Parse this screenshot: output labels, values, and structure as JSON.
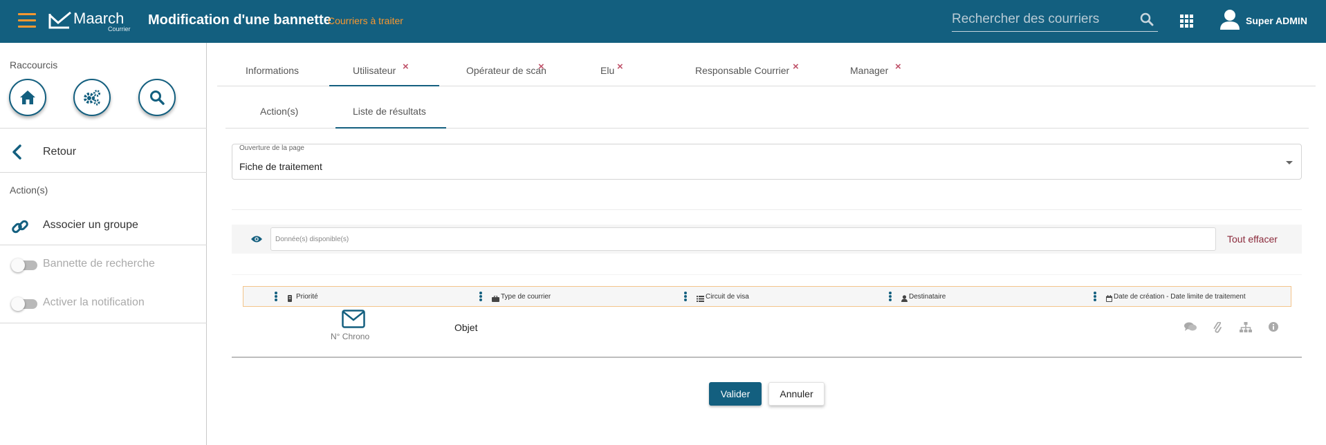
{
  "header": {
    "app_name": "Maarch",
    "app_sub": "Courrier",
    "title": "Modification d'une bannette",
    "subtitle": "Courriers à traiter",
    "search_placeholder": "Rechercher des courriers",
    "user_name": "Super ADMIN",
    "accent_color": "#f99830",
    "bar_color": "#135f7f"
  },
  "sidebar": {
    "shortcuts_title": "Raccourcis",
    "shortcuts": [
      "home-icon",
      "gears-icon",
      "search-icon"
    ],
    "back_label": "Retour",
    "actions_title": "Action(s)",
    "associate_label": "Associer un groupe",
    "toggles": [
      {
        "label": "Bannette de recherche",
        "on": false
      },
      {
        "label": "Activer la notification",
        "on": false
      }
    ]
  },
  "tabs": [
    {
      "label": "Informations",
      "closable": false,
      "active": false
    },
    {
      "label": "Utilisateur",
      "closable": true,
      "active": true
    },
    {
      "label": "Opérateur de scan",
      "closable": true,
      "active": false
    },
    {
      "label": "Elu",
      "closable": true,
      "active": false
    },
    {
      "label": "Responsable Courrier",
      "closable": true,
      "active": false
    },
    {
      "label": "Manager",
      "closable": true,
      "active": false
    }
  ],
  "close_glyph": "×",
  "subtabs": [
    {
      "label": "Action(s)",
      "active": false
    },
    {
      "label": "Liste de résultats",
      "active": true
    }
  ],
  "page_open": {
    "label": "Ouverture de la page",
    "value": "Fiche de traitement"
  },
  "filter": {
    "placeholder": "Donnée(s) disponible(s)",
    "clear_label": "Tout effacer"
  },
  "columns": [
    {
      "label": "Priorité",
      "icon": "priority-icon"
    },
    {
      "label": "Type de courrier",
      "icon": "briefcase-icon"
    },
    {
      "label": "Circuit de visa",
      "icon": "list-icon"
    },
    {
      "label": "Destinataire",
      "icon": "user-icon"
    },
    {
      "label": "Date de création - Date limite de traitement",
      "icon": "calendar-icon"
    }
  ],
  "result": {
    "chrono_label": "N° Chrono",
    "objet_label": "Objet",
    "icons": [
      "comments-icon",
      "paperclip-icon",
      "sitemap-icon",
      "info-icon"
    ]
  },
  "buttons": {
    "validate": "Valider",
    "cancel": "Annuler"
  }
}
